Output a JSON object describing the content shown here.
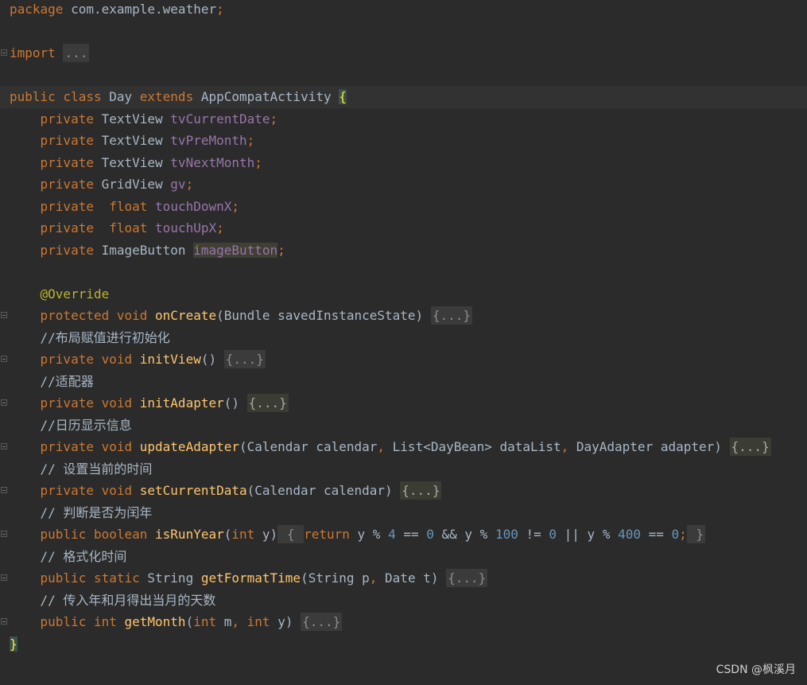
{
  "editor": {
    "lines": [
      {
        "tokens": [
          [
            "kw",
            "package"
          ],
          [
            "t",
            " com.example.weather"
          ],
          [
            "kw",
            ";"
          ]
        ]
      },
      {
        "tokens": []
      },
      {
        "fold": true,
        "tokens": [
          [
            "kw",
            "import"
          ],
          [
            "t",
            " "
          ],
          [
            "fold",
            "..."
          ]
        ]
      },
      {
        "tokens": []
      },
      {
        "current": true,
        "tokens": [
          [
            "kw",
            "public class"
          ],
          [
            "t",
            " Day "
          ],
          [
            "kw",
            "extends"
          ],
          [
            "t",
            " AppCompatActivity "
          ],
          [
            "brace",
            "{"
          ]
        ]
      },
      {
        "tokens": [
          [
            "t",
            "    "
          ],
          [
            "kw",
            "private"
          ],
          [
            "t",
            " TextView "
          ],
          [
            "fld",
            "tvCurrentDate"
          ],
          [
            "kw",
            ";"
          ]
        ]
      },
      {
        "tokens": [
          [
            "t",
            "    "
          ],
          [
            "kw",
            "private"
          ],
          [
            "t",
            " TextView "
          ],
          [
            "fld",
            "tvPreMonth"
          ],
          [
            "kw",
            ";"
          ]
        ]
      },
      {
        "tokens": [
          [
            "t",
            "    "
          ],
          [
            "kw",
            "private"
          ],
          [
            "t",
            " TextView "
          ],
          [
            "fld",
            "tvNextMonth"
          ],
          [
            "kw",
            ";"
          ]
        ]
      },
      {
        "tokens": [
          [
            "t",
            "    "
          ],
          [
            "kw",
            "private"
          ],
          [
            "t",
            " GridView "
          ],
          [
            "fld",
            "gv"
          ],
          [
            "kw",
            ";"
          ]
        ]
      },
      {
        "tokens": [
          [
            "t",
            "    "
          ],
          [
            "kw",
            "private"
          ],
          [
            "t",
            "  "
          ],
          [
            "kw",
            "float"
          ],
          [
            "t",
            " "
          ],
          [
            "fld",
            "touchDownX"
          ],
          [
            "kw",
            ";"
          ]
        ]
      },
      {
        "tokens": [
          [
            "t",
            "    "
          ],
          [
            "kw",
            "private"
          ],
          [
            "t",
            "  "
          ],
          [
            "kw",
            "float"
          ],
          [
            "t",
            " "
          ],
          [
            "fld",
            "touchUpX"
          ],
          [
            "kw",
            ";"
          ]
        ]
      },
      {
        "tokens": [
          [
            "t",
            "    "
          ],
          [
            "kw",
            "private"
          ],
          [
            "t",
            " ImageButton "
          ],
          [
            "sel",
            "imageButton"
          ],
          [
            "kw",
            ";"
          ]
        ]
      },
      {
        "tokens": []
      },
      {
        "tokens": [
          [
            "t",
            "    "
          ],
          [
            "ann",
            "@Override"
          ]
        ]
      },
      {
        "fold": true,
        "tokens": [
          [
            "t",
            "    "
          ],
          [
            "kw",
            "protected void"
          ],
          [
            "t",
            " "
          ],
          [
            "fn",
            "onCreate"
          ],
          [
            "t",
            "(Bundle savedInstanceState) "
          ],
          [
            "fold",
            "{...}"
          ]
        ]
      },
      {
        "tokens": [
          [
            "t",
            "    "
          ],
          [
            "cm",
            "//布局赋值进行初始化"
          ]
        ]
      },
      {
        "fold": true,
        "tokens": [
          [
            "t",
            "    "
          ],
          [
            "kw",
            "private void"
          ],
          [
            "t",
            " "
          ],
          [
            "fn",
            "initView"
          ],
          [
            "t",
            "() "
          ],
          [
            "fold",
            "{...}"
          ]
        ]
      },
      {
        "tokens": [
          [
            "t",
            "    "
          ],
          [
            "cm",
            "//适配器"
          ]
        ]
      },
      {
        "fold": true,
        "tokens": [
          [
            "t",
            "    "
          ],
          [
            "kw",
            "private void"
          ],
          [
            "t",
            " "
          ],
          [
            "fn",
            "initAdapter"
          ],
          [
            "t",
            "() "
          ],
          [
            "foldhl",
            "{...}"
          ]
        ]
      },
      {
        "tokens": [
          [
            "t",
            "    "
          ],
          [
            "cm",
            "//日历显示信息"
          ]
        ]
      },
      {
        "fold": true,
        "tokens": [
          [
            "t",
            "    "
          ],
          [
            "kw",
            "private void"
          ],
          [
            "t",
            " "
          ],
          [
            "fn",
            "updateAdapter"
          ],
          [
            "t",
            "(Calendar calendar"
          ],
          [
            "kw",
            ","
          ],
          [
            "t",
            " List<DayBean> dataList"
          ],
          [
            "kw",
            ","
          ],
          [
            "t",
            " DayAdapter adapter) "
          ],
          [
            "foldhl",
            "{...}"
          ]
        ]
      },
      {
        "tokens": [
          [
            "t",
            "    "
          ],
          [
            "cm",
            "// 设置当前的时间"
          ]
        ]
      },
      {
        "fold": true,
        "tokens": [
          [
            "t",
            "    "
          ],
          [
            "kw",
            "private void"
          ],
          [
            "t",
            " "
          ],
          [
            "fn",
            "setCurrentData"
          ],
          [
            "t",
            "(Calendar calendar) "
          ],
          [
            "foldhl",
            "{...}"
          ]
        ]
      },
      {
        "tokens": [
          [
            "t",
            "    "
          ],
          [
            "cm",
            "// 判断是否为闰年"
          ]
        ]
      },
      {
        "fold": true,
        "tokens": [
          [
            "t",
            "    "
          ],
          [
            "kw",
            "public boolean"
          ],
          [
            "t",
            " "
          ],
          [
            "fn",
            "isRunYear"
          ],
          [
            "t",
            "("
          ],
          [
            "kw",
            "int"
          ],
          [
            "t",
            " y)"
          ],
          [
            "fold",
            " { "
          ],
          [
            "kw",
            "return"
          ],
          [
            "t",
            " y % "
          ],
          [
            "num",
            "4"
          ],
          [
            "t",
            " == "
          ],
          [
            "num",
            "0"
          ],
          [
            "t",
            " && y % "
          ],
          [
            "num",
            "100"
          ],
          [
            "t",
            " != "
          ],
          [
            "num",
            "0"
          ],
          [
            "t",
            " || y % "
          ],
          [
            "num",
            "400"
          ],
          [
            "t",
            " == "
          ],
          [
            "num",
            "0"
          ],
          [
            "kw",
            ";"
          ],
          [
            "fold",
            " }"
          ]
        ]
      },
      {
        "tokens": [
          [
            "t",
            "    "
          ],
          [
            "cm",
            "// 格式化时间"
          ]
        ]
      },
      {
        "fold": true,
        "tokens": [
          [
            "t",
            "    "
          ],
          [
            "kw",
            "public static"
          ],
          [
            "t",
            " String "
          ],
          [
            "fn",
            "getFormatTime"
          ],
          [
            "t",
            "(String p"
          ],
          [
            "kw",
            ","
          ],
          [
            "t",
            " Date t) "
          ],
          [
            "fold",
            "{...}"
          ]
        ]
      },
      {
        "tokens": [
          [
            "t",
            "    "
          ],
          [
            "cm",
            "// 传入年和月得出当月的天数"
          ]
        ]
      },
      {
        "fold": true,
        "tokens": [
          [
            "t",
            "    "
          ],
          [
            "kw",
            "public int"
          ],
          [
            "t",
            " "
          ],
          [
            "fn",
            "getMonth"
          ],
          [
            "t",
            "("
          ],
          [
            "kw",
            "int"
          ],
          [
            "t",
            " m"
          ],
          [
            "kw",
            ","
          ],
          [
            "t",
            " "
          ],
          [
            "kw",
            "int"
          ],
          [
            "t",
            " y) "
          ],
          [
            "fold",
            "{...}"
          ]
        ]
      },
      {
        "tokens": [
          [
            "brace",
            "}"
          ]
        ]
      }
    ]
  },
  "watermark": "CSDN @枫溪月",
  "colors": {
    "background": "#2b2b2b",
    "keyword": "#cc7832",
    "field": "#9876aa",
    "annotation": "#bbb529",
    "method": "#ffc66d",
    "number": "#6897bb",
    "text": "#a9b7c6"
  }
}
